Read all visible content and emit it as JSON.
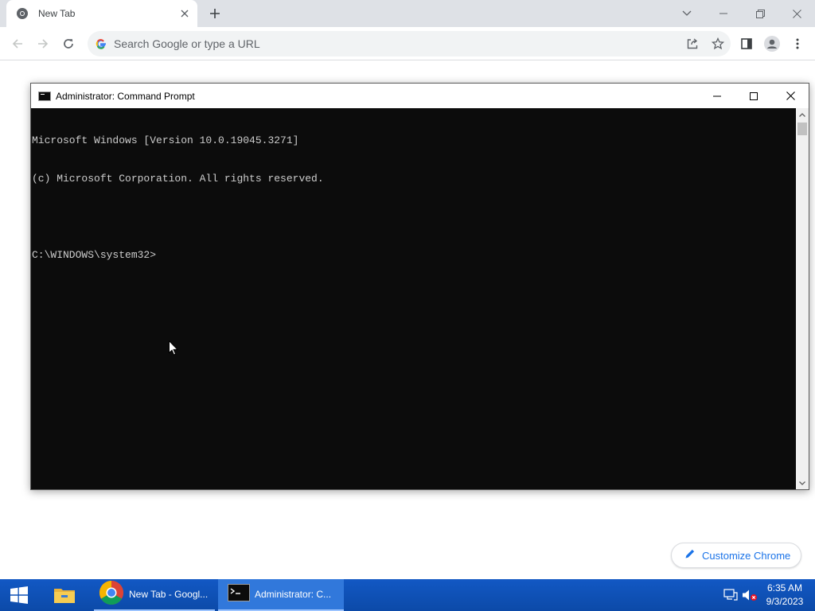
{
  "chrome": {
    "tab_title": "New Tab",
    "omnibox_placeholder": "Search Google or type a URL",
    "customize_label": "Customize Chrome"
  },
  "cmd": {
    "title": "Administrator: Command Prompt",
    "lines": [
      "Microsoft Windows [Version 10.0.19045.3271]",
      "(c) Microsoft Corporation. All rights reserved.",
      "",
      "C:\\WINDOWS\\system32>"
    ]
  },
  "taskbar": {
    "chrome_label": "New Tab - Googl...",
    "cmd_label": "Administrator: C...",
    "time": "6:35 AM",
    "date": "9/3/2023"
  },
  "colors": {
    "taskbar": "#0c4aa8",
    "console_bg": "#0c0c0c",
    "console_fg": "#cccccc",
    "link_blue": "#1a73e8"
  },
  "icons": {
    "start": "windows-start-icon",
    "explorer": "file-explorer-icon",
    "chrome": "chrome-icon",
    "cmd": "cmd-icon",
    "network": "network-icon",
    "volume": "volume-muted-icon"
  }
}
